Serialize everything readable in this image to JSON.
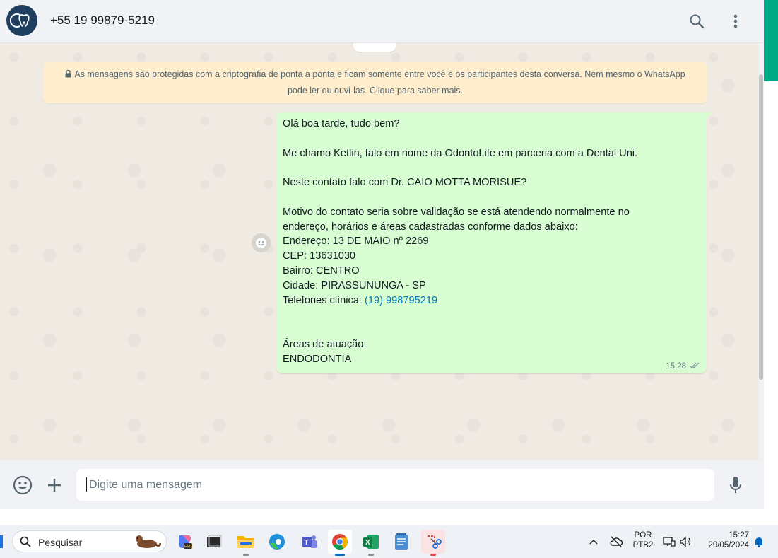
{
  "header": {
    "contact": "+55 19 99879-5219",
    "icons": [
      "avatar-logo",
      "search-icon",
      "menu-dots-icon"
    ]
  },
  "notice": {
    "text": "As mensagens são protegidas com a criptografia de ponta a ponta e ficam somente entre você e os participantes desta conversa. Nem mesmo o WhatsApp pode ler ou ouvi-las. Clique para saber mais."
  },
  "message": {
    "lines": [
      "Olá boa tarde, tudo bem?",
      "",
      "Me chamo Ketlin, falo em nome da OdontoLife em parceria com a Dental Uni.",
      "",
      "Neste contato falo com Dr. CAIO MOTTA MORISUE?",
      "",
      "Motivo do contato seria sobre validação se está atendendo normalmente no",
      "endereço, horários e áreas cadastradas conforme dados abaixo:",
      "Endereço: 13 DE MAIO nº 2269",
      "CEP: 13631030",
      "Bairro: CENTRO",
      "Cidade: PIRASSUNUNGA - SP"
    ],
    "phone_label": "Telefones clínica: ",
    "phone_link": "(19) 998795219",
    "lines_after": [
      "",
      "",
      "Áreas de atuação:",
      "ENDODONTIA"
    ],
    "time": "15:28",
    "status": "double-check-icon"
  },
  "composer": {
    "placeholder": "Digite uma mensagem",
    "value": "",
    "icons": [
      "emoji-icon",
      "plus-icon",
      "microphone-icon"
    ]
  },
  "taskbar": {
    "search_placeholder": "Pesquisar",
    "apps": [
      "copilot-icon",
      "terminal-icon",
      "file-explorer-icon",
      "edge-icon",
      "teams-icon",
      "chrome-icon",
      "excel-icon",
      "notepad-icon",
      "snipping-tool-icon"
    ],
    "active_app": "chrome-icon",
    "language_top": "POR",
    "language_bottom": "PTB2",
    "time": "15:27",
    "date": "29/05/2024"
  },
  "colors": {
    "bubble": "#d9fdd3",
    "notice": "#ffeecd",
    "accent": "#00a884",
    "link": "#027eb5"
  }
}
